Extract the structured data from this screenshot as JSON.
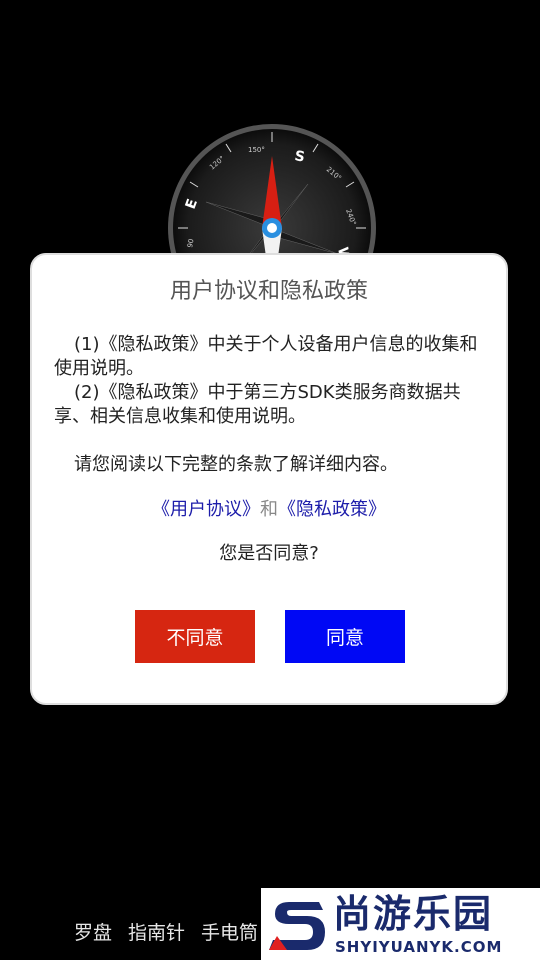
{
  "compass": {
    "north_letter": "S",
    "east_letter": "E",
    "west_letter": "W",
    "deg_150": "150°",
    "deg_120": "120°",
    "deg_210": "210°",
    "deg_240": "240°",
    "deg_90": "90"
  },
  "dialog": {
    "title": "用户协议和隐私政策",
    "items": [
      "(1)《隐私政策》中关于个人设备用户信息的收集和使用说明。",
      "(2)《隐私政策》中于第三方SDK类服务商数据共享、相关信息收集和使用说明。"
    ],
    "notice": "请您阅读以下完整的条款了解详细内容。",
    "user_agreement_link": "《用户协议》",
    "and_text": "和",
    "privacy_policy_link": "《隐私政策》",
    "question": "您是否同意?",
    "disagree_label": "不同意",
    "agree_label": "同意"
  },
  "bottom_nav": {
    "items": [
      "罗盘",
      "指南针",
      "手电筒"
    ]
  },
  "watermark": {
    "brand": "尚游乐园",
    "url": "SHYIYUANYK.COM"
  },
  "colors": {
    "disagree": "#d62611",
    "agree": "#0008f5",
    "link": "#1d1daa"
  }
}
